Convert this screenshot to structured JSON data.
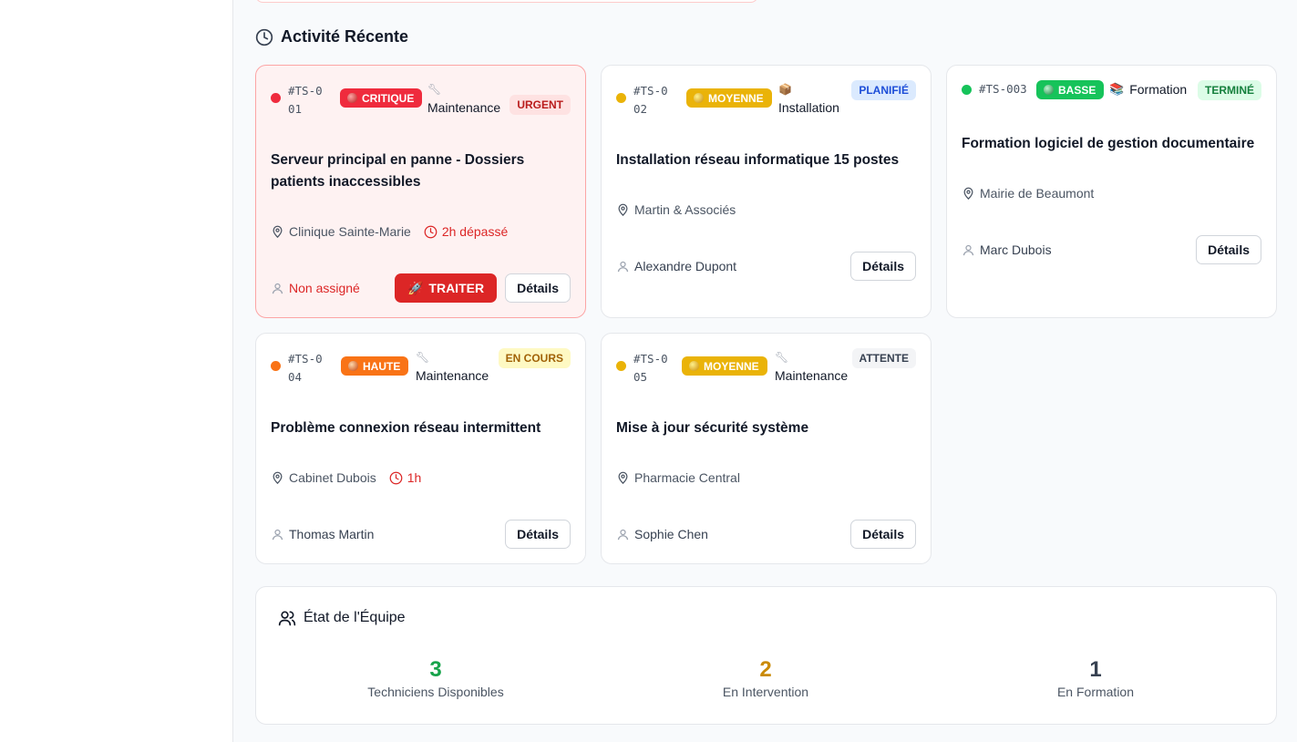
{
  "section": {
    "title": "Activité Récente"
  },
  "tickets": [
    {
      "id": "#TS-001",
      "priority": "CRITIQUE",
      "category": "Maintenance",
      "category_icon": "wrench",
      "status": "URGENT",
      "title": "Serveur principal en panne - Dossiers patients inaccessibles",
      "location": "Clinique Sainte-Marie",
      "overdue": "2h dépassé",
      "assignee": "Non assigné",
      "action": "TRAITER",
      "details": "Détails"
    },
    {
      "id": "#TS-002",
      "priority": "MOYENNE",
      "category": "Installation",
      "category_icon": "package",
      "status": "PLANIFIÉ",
      "title": "Installation réseau informatique 15 postes",
      "location": "Martin & Associés",
      "assignee": "Alexandre Dupont",
      "details": "Détails"
    },
    {
      "id": "#TS-003",
      "priority": "BASSE",
      "category": "Formation",
      "category_icon": "books",
      "status": "TERMINÉ",
      "title": "Formation logiciel de gestion documentaire",
      "location": "Mairie de Beaumont",
      "assignee": "Marc Dubois",
      "details": "Détails"
    },
    {
      "id": "#TS-004",
      "priority": "HAUTE",
      "category": "Maintenance",
      "category_icon": "wrench",
      "status": "EN COURS",
      "title": "Problème connexion réseau intermittent",
      "location": "Cabinet Dubois",
      "overdue": "1h",
      "assignee": "Thomas Martin",
      "details": "Détails"
    },
    {
      "id": "#TS-005",
      "priority": "MOYENNE",
      "category": "Maintenance",
      "category_icon": "wrench",
      "status": "ATTENTE",
      "title": "Mise à jour sécurité système",
      "location": "Pharmacie Central",
      "assignee": "Sophie Chen",
      "details": "Détails"
    }
  ],
  "team": {
    "title": "État de l'Équipe",
    "stats": [
      {
        "value": "3",
        "label": "Techniciens Disponibles",
        "color": "#16a34a"
      },
      {
        "value": "2",
        "label": "En Intervention",
        "color": "#ca8a04"
      },
      {
        "value": "1",
        "label": "En Formation",
        "color": "#374151"
      }
    ]
  },
  "colors": {
    "critique": "#ef2b3d",
    "haute": "#f97316",
    "moyenne": "#eab308",
    "basse": "#16c35a",
    "urgent_bg": "#fee2e2",
    "urgent_fg": "#b91c1c",
    "planifie_bg": "#dbeafe",
    "planifie_fg": "#1d4ed8",
    "termine_bg": "#dcfce7",
    "termine_fg": "#15803d",
    "encours_bg": "#fef9c3",
    "encours_fg": "#a16207",
    "attente_bg": "#f3f4f6",
    "attente_fg": "#374151"
  }
}
